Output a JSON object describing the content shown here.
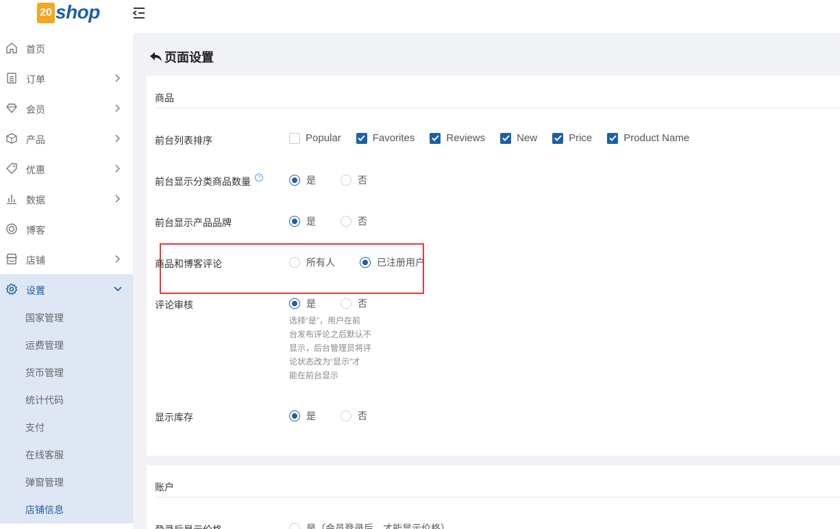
{
  "brand": {
    "logo_badge": "20",
    "logo_text": "shop",
    "accent": "#1e5fa8",
    "badge_color": "#f5a623"
  },
  "sidebar": {
    "items": [
      {
        "label": "首页",
        "icon": "home-icon",
        "has_children": false
      },
      {
        "label": "订单",
        "icon": "clipboard-icon",
        "has_children": true
      },
      {
        "label": "会员",
        "icon": "diamond-icon",
        "has_children": true
      },
      {
        "label": "产品",
        "icon": "box-icon",
        "has_children": true
      },
      {
        "label": "优惠",
        "icon": "tag-icon",
        "has_children": true
      },
      {
        "label": "数据",
        "icon": "bar-chart-icon",
        "has_children": true
      },
      {
        "label": "博客",
        "icon": "blog-icon",
        "has_children": false
      },
      {
        "label": "店铺",
        "icon": "store-icon",
        "has_children": true
      },
      {
        "label": "设置",
        "icon": "gear-icon",
        "has_children": true,
        "expanded": true
      }
    ],
    "sub_items": [
      "国家管理",
      "运费管理",
      "货币管理",
      "统计代码",
      "支付",
      "在线客服",
      "弹窗管理",
      "店铺信息"
    ],
    "current_sub": "店铺信息"
  },
  "page": {
    "title": "页面设置",
    "back_icon": "back-arrow-icon"
  },
  "products_section": {
    "title": "商品",
    "sort": {
      "label": "前台列表排序",
      "options": [
        {
          "label": "Popular",
          "checked": false
        },
        {
          "label": "Favorites",
          "checked": true
        },
        {
          "label": "Reviews",
          "checked": true
        },
        {
          "label": "New",
          "checked": true
        },
        {
          "label": "Price",
          "checked": true
        },
        {
          "label": "Product Name",
          "checked": true
        }
      ]
    },
    "show_category_count": {
      "label": "前台显示分类商品数量",
      "help": "?",
      "yes": "是",
      "no": "否",
      "value": "yes"
    },
    "show_brand": {
      "label": "前台显示产品品牌",
      "yes": "是",
      "no": "否",
      "value": "yes",
      "highlighted": true
    },
    "comments": {
      "label": "商品和博客评论",
      "everyone": "所有人",
      "registered": "已注册用户",
      "value": "registered"
    },
    "review_moderation": {
      "label": "评论审核",
      "yes": "是",
      "no": "否",
      "value": "yes",
      "note_lines": [
        "选择“是”，用户在前",
        "台发布评论之后默认不",
        "显示，后台管理员将评",
        "论状态改为“显示”才",
        "能在前台显示"
      ]
    },
    "show_stock": {
      "label": "显示库存",
      "yes": "是",
      "no": "否",
      "value": "yes"
    }
  },
  "account_section": {
    "title": "账户",
    "login_price": {
      "label": "登录后显示价格",
      "yes": "是（会员登录后，才能显示价格）"
    }
  }
}
